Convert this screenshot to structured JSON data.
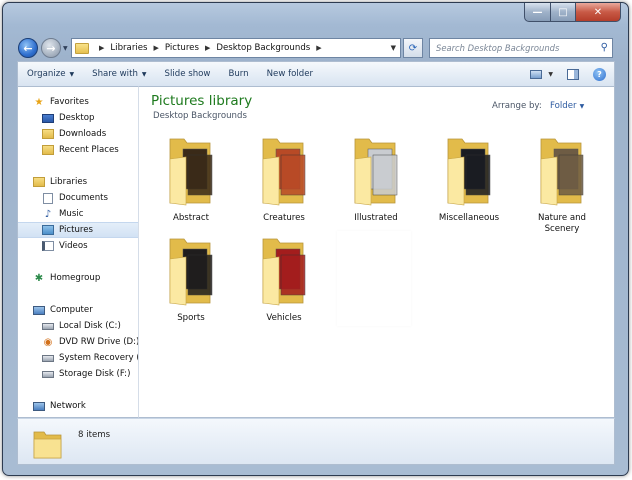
{
  "window": {
    "min_glyph": "—",
    "max_glyph": "□",
    "close_glyph": "✕"
  },
  "address": {
    "crumbs": [
      "Libraries",
      "Pictures",
      "Desktop Backgrounds"
    ],
    "search_placeholder": "Search Desktop Backgrounds"
  },
  "commands": {
    "organize": "Organize",
    "share_with": "Share with",
    "slide_show": "Slide show",
    "burn": "Burn",
    "new_folder": "New folder"
  },
  "nav": {
    "favorites": "Favorites",
    "desktop": "Desktop",
    "downloads": "Downloads",
    "recent_places": "Recent Places",
    "libraries": "Libraries",
    "documents": "Documents",
    "music": "Music",
    "pictures": "Pictures",
    "videos": "Videos",
    "homegroup": "Homegroup",
    "computer": "Computer",
    "local_disk": "Local Disk (C:)",
    "dvd_drive": "DVD RW Drive (D:) A",
    "system_recovery": "System Recovery (E:",
    "storage_disk": "Storage Disk (F:)",
    "network": "Network"
  },
  "main": {
    "title": "Pictures library",
    "subtitle": "Desktop Backgrounds",
    "arrange_label": "Arrange by:",
    "arrange_value": "Folder"
  },
  "folders": [
    {
      "name": "Abstract",
      "theme": "#3a2a18"
    },
    {
      "name": "Creatures",
      "theme": "#b84a26"
    },
    {
      "name": "Illustrated",
      "theme": "#c9ccd0"
    },
    {
      "name": "Miscellaneous",
      "theme": "#1a1c22"
    },
    {
      "name": "Nature and Scenery",
      "theme": "#6e5c44"
    },
    {
      "name": "Sports",
      "theme": "#1f1d1d"
    },
    {
      "name": "Vehicles",
      "theme": "#a31d1d"
    }
  ],
  "status": {
    "count": "8 items"
  },
  "colors": {
    "accent": "#1e7a1e",
    "link": "#2c5aa0"
  }
}
